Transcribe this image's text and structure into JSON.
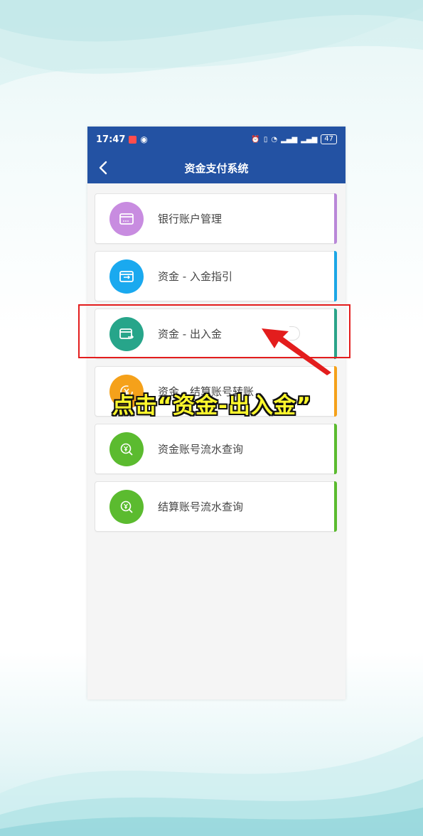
{
  "status_bar": {
    "time": "17:47",
    "battery": "47"
  },
  "navbar": {
    "title": "资金支付系统"
  },
  "menu": {
    "items": [
      {
        "label": "银行账户管理",
        "icon": "bank-card-icon",
        "icon_color": "#c88ce0",
        "stripe_color": "#b987d8"
      },
      {
        "label": "资金 - 入金指引",
        "icon": "card-guide-icon",
        "icon_color": "#1aa9ef",
        "stripe_color": "#1ba6e6"
      },
      {
        "label": "资金 - 出入金",
        "icon": "card-transfer-icon",
        "icon_color": "#27a58a",
        "stripe_color": "#2aa388"
      },
      {
        "label": "资金 - 结算账号转账",
        "icon": "yuan-transfer-icon",
        "icon_color": "#f5a11a",
        "stripe_color": "#f5a11a"
      },
      {
        "label": "资金账号流水查询",
        "icon": "yuan-search-icon",
        "icon_color": "#5bbb2f",
        "stripe_color": "#5bbb2f"
      },
      {
        "label": "结算账号流水查询",
        "icon": "yuan-search-icon",
        "icon_color": "#5bbb2f",
        "stripe_color": "#5bbb2f"
      }
    ]
  },
  "annotation": {
    "callout": "点击“资金-出入金”",
    "highlight_color": "#e31d1d",
    "callout_color": "#fff92d"
  },
  "theme": {
    "header_color": "#2352a3"
  }
}
